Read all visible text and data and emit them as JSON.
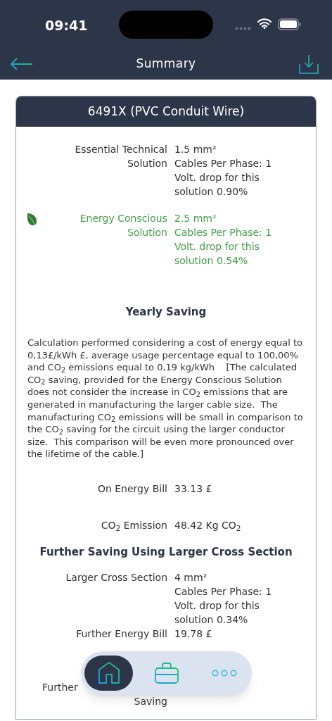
{
  "status_bar": {
    "time": "09:41"
  },
  "nav": {
    "title": "Summary"
  },
  "card": {
    "title": "6491X (PVC Conduit Wire)",
    "solutions": [
      {
        "kind": "standard",
        "label": "Essential Technical Solution",
        "lines": [
          "1.5 mm²",
          "Cables Per Phase:  1",
          "Volt. drop for this solution 0.90%"
        ]
      },
      {
        "kind": "eco",
        "label": "Energy Conscious Solution",
        "lines": [
          "2.5 mm²",
          "Cables Per Phase:  1",
          "Volt. drop for this solution 0.54%"
        ]
      }
    ],
    "yearly_saving": {
      "heading": "Yearly Saving",
      "note": "Calculation performed considering a cost of energy equal to 0,13£/kWh £, average usage percentage equal to 100,00% and CO$_{2}$ emissions equal to 0,19 kg/kWh    [The calculated CO$_{2}$ saving, provided for the Energy Conscious Solution does not consider the increase in CO$_{2}$ emissions that are generated in manufacturing the larger cable size.  The  manufacturing CO$_{2}$ emissions will be small in comparison to the CO$_{2}$ saving for the circuit using the larger conductor size.  This comparison will be even more pronounced over the lifetime of the cable.]",
      "rows": [
        {
          "label": "On Energy Bill",
          "value": "33.13 £"
        },
        {
          "label": "CO$_{2}$ Emission",
          "value": "48.42 Kg CO$_{2}$"
        }
      ]
    },
    "further": {
      "heading": "Further Saving Using Larger Cross Section",
      "rows": [
        {
          "kind": "full",
          "label": "Larger Cross Section",
          "lines": [
            "4 mm²",
            "Cables Per Phase:  1",
            "Volt. drop for this solution 0.34%"
          ]
        },
        {
          "kind": "full",
          "label": "Further Energy Bill",
          "lines": [
            "19.78 £"
          ]
        },
        {
          "kind": "partial",
          "label_fragments": [
            "Further",
            "Saving"
          ]
        }
      ]
    }
  },
  "tab_bar": [
    {
      "kind": "home",
      "selected": true
    },
    {
      "kind": "briefcase",
      "selected": false
    },
    {
      "kind": "more",
      "selected": false
    }
  ]
}
